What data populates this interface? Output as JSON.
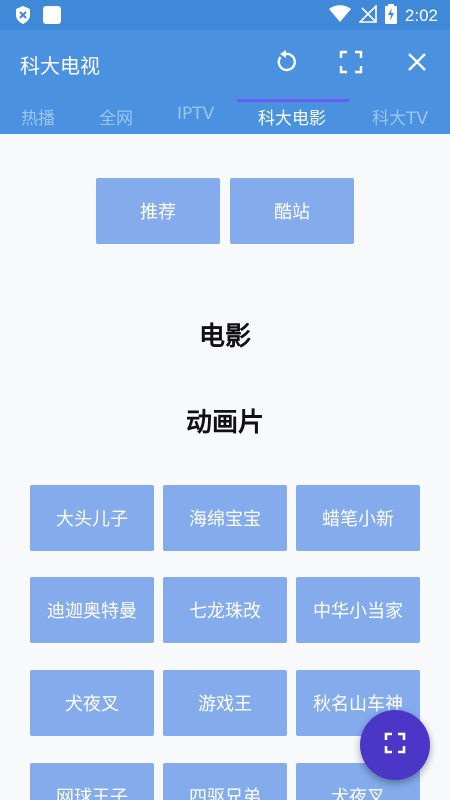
{
  "status_bar": {
    "time": "2:02",
    "icons": [
      "shield-x-icon",
      "square-notification-icon",
      "wifi-icon",
      "no-signal-icon",
      "battery-charging-icon"
    ]
  },
  "app_bar": {
    "title": "科大电视",
    "actions": [
      "refresh-icon",
      "fullscreen-icon",
      "close-icon"
    ]
  },
  "tabs": [
    {
      "label": "热播"
    },
    {
      "label": "全网"
    },
    {
      "label": "IPTV"
    },
    {
      "label": "科大电影",
      "active": true
    },
    {
      "label": "科大TV"
    }
  ],
  "top_buttons": [
    {
      "label": "推荐"
    },
    {
      "label": "酷站"
    }
  ],
  "section_headings": [
    "电影",
    "动画片"
  ],
  "cartoons": [
    "大头儿子",
    "海绵宝宝",
    "蜡笔小新",
    "迪迦奥特曼",
    "七龙珠改",
    "中华小当家",
    "犬夜叉",
    "游戏王",
    "秋名山车神",
    "网球王子",
    "四驱兄弟",
    "犬夜叉"
  ],
  "fab": {
    "icon": "fullscreen-icon"
  },
  "colors": {
    "status_bar": "#3f89d8",
    "app_bar": "#4a92df",
    "tab_indicator": "#6a5cf0",
    "button": "#84aced",
    "fab": "#4b36c8"
  }
}
